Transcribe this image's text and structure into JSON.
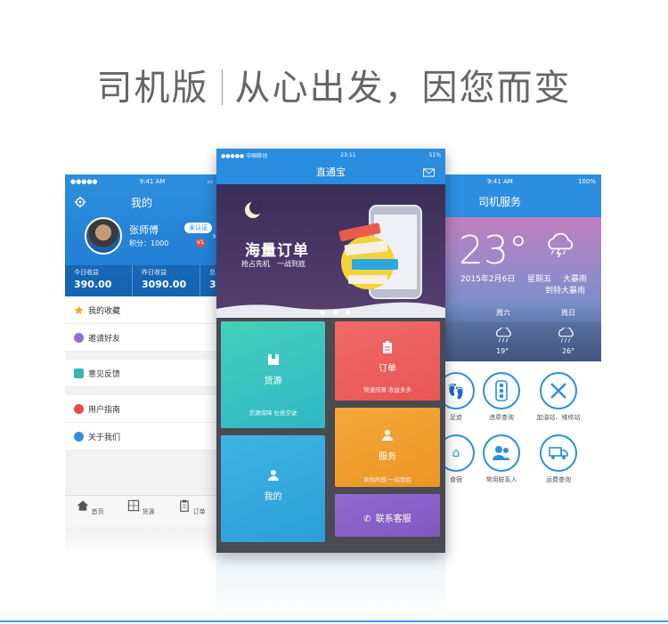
{
  "headline": {
    "left": "司机版",
    "right": "从心出发，因您而变"
  },
  "left_phone": {
    "status": {
      "carrier": "●●●●● ",
      "time": "9:41 AM"
    },
    "title": "我的",
    "profile": {
      "name": "张师傅",
      "badge": "未认证",
      "points": "积分：1000",
      "level": "V1"
    },
    "income": [
      {
        "label": "今日收益",
        "value": "390.00"
      },
      {
        "label": "昨日收益",
        "value": "3090.00"
      },
      {
        "label": "总",
        "value": "3"
      }
    ],
    "menu": [
      {
        "label": "我的收藏",
        "color": "#f5a623"
      },
      {
        "label": "邀请好友",
        "color": "#8e6fd6"
      },
      {
        "label": "意见反馈",
        "color": "#3ab5a8"
      },
      {
        "label": "用户指南",
        "color": "#e74c3c"
      },
      {
        "label": "关于我们",
        "color": "#2d8fdf"
      }
    ],
    "tabs": [
      {
        "label": "首页",
        "icon": "home-icon"
      },
      {
        "label": "货源",
        "icon": "grid-icon"
      },
      {
        "label": "订单",
        "icon": "clipboard-icon"
      }
    ]
  },
  "center_phone": {
    "status": {
      "carrier": "●●●●● 中国移动",
      "time": "23:11",
      "battery": "51%"
    },
    "title": "直通宝",
    "banner": {
      "title": "海量订单",
      "subtitle": "抢占先机　一战到底"
    },
    "tiles": {
      "goods": {
        "title": "货源",
        "subtitle": "货源保障 杜绝空驶",
        "color": "#3cc3b8"
      },
      "orders": {
        "title": "订单",
        "subtitle": "快速结算 收益多多",
        "color": "#ef6060"
      },
      "mine": {
        "title": "我的",
        "color": "#30a8dc"
      },
      "service": {
        "title": "服务",
        "subtitle": "享你所想 一站到底",
        "color": "#f4a030"
      },
      "contact": {
        "title": "联系客服",
        "color": "#8c62c8"
      }
    }
  },
  "right_phone": {
    "status": {
      "time": "9:41 AM",
      "battery": "100%"
    },
    "title": "司机服务",
    "weather": {
      "temperature": "23°",
      "date": "2015年2月6日",
      "weekday": "星期五",
      "condition": "大暴雨",
      "city_line": "到特大暴雨",
      "forecast": [
        {
          "day": "周六",
          "temp": "19°"
        },
        {
          "day": "周日",
          "temp": "26°"
        }
      ]
    },
    "services": [
      {
        "label": "足迹",
        "icon": "footprint-icon"
      },
      {
        "label": "违章查询",
        "icon": "traffic-light-icon"
      },
      {
        "label": "加油站、维修站",
        "icon": "tools-icon"
      },
      {
        "label": "食宿",
        "icon": "bed-icon"
      },
      {
        "label": "常用联系人",
        "icon": "contacts-icon"
      },
      {
        "label": "运费查询",
        "icon": "truck-icon"
      }
    ]
  }
}
